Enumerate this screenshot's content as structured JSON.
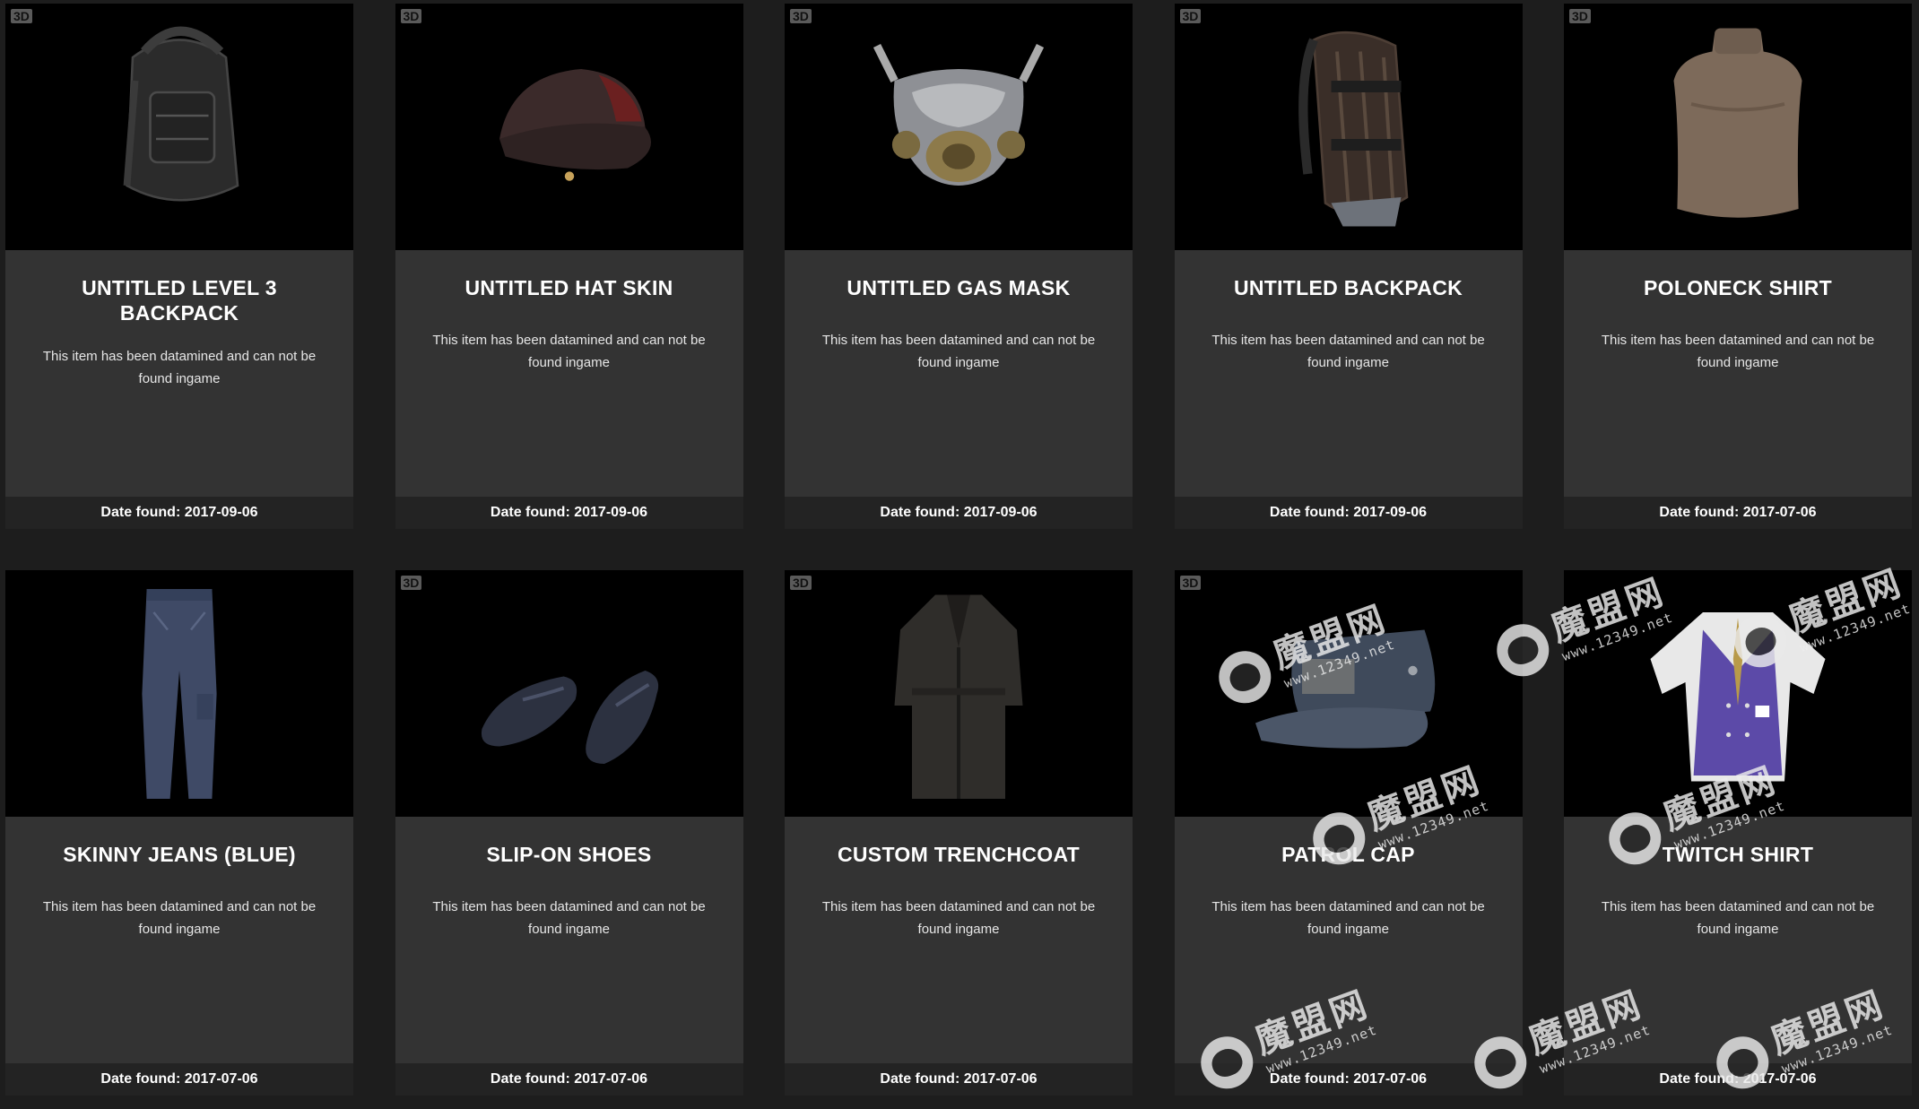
{
  "items": [
    {
      "badge": "3D",
      "title": "UNTITLED LEVEL 3 BACKPACK",
      "desc": "This item has been datamined and can not be found ingame",
      "date": "Date found: 2017-09-06",
      "icon": "backpack-icon"
    },
    {
      "badge": "3D",
      "title": "UNTITLED HAT SKIN",
      "desc": "This item has been datamined and can not be found ingame",
      "date": "Date found: 2017-09-06",
      "icon": "hat-icon"
    },
    {
      "badge": "3D",
      "title": "UNTITLED GAS MASK",
      "desc": "This item has been datamined and can not be found ingame",
      "date": "Date found: 2017-09-06",
      "icon": "gas-mask-icon"
    },
    {
      "badge": "3D",
      "title": "UNTITLED BACKPACK",
      "desc": "This item has been datamined and can not be found ingame",
      "date": "Date found: 2017-09-06",
      "icon": "backpack-icon"
    },
    {
      "badge": "3D",
      "title": "POLONECK SHIRT",
      "desc": "This item has been datamined and can not be found ingame",
      "date": "Date found: 2017-07-06",
      "icon": "shirt-icon"
    },
    {
      "badge": "",
      "title": "SKINNY JEANS (BLUE)",
      "desc": "This item has been datamined and can not be found ingame",
      "date": "Date found: 2017-07-06",
      "icon": "jeans-icon"
    },
    {
      "badge": "3D",
      "title": "SLIP-ON SHOES",
      "desc": "This item has been datamined and can not be found ingame",
      "date": "Date found: 2017-07-06",
      "icon": "shoes-icon"
    },
    {
      "badge": "3D",
      "title": "CUSTOM TRENCHCOAT",
      "desc": "This item has been datamined and can not be found ingame",
      "date": "Date found: 2017-07-06",
      "icon": "trenchcoat-icon"
    },
    {
      "badge": "3D",
      "title": "PATROL CAP",
      "desc": "This item has been datamined and can not be found ingame",
      "date": "Date found: 2017-07-06",
      "icon": "cap-icon"
    },
    {
      "badge": "",
      "title": "TWITCH SHIRT",
      "desc": "This item has been datamined and can not be found ingame",
      "date": "Date found: 2017-07-06",
      "icon": "vest-shirt-icon"
    }
  ],
  "watermark": {
    "cn": "魔盟网",
    "url": "www.12349.net"
  },
  "colors": {
    "card": "#333333",
    "image_bg": "#000000",
    "footer": "#232323",
    "page_bg": "#1d1d1d"
  }
}
